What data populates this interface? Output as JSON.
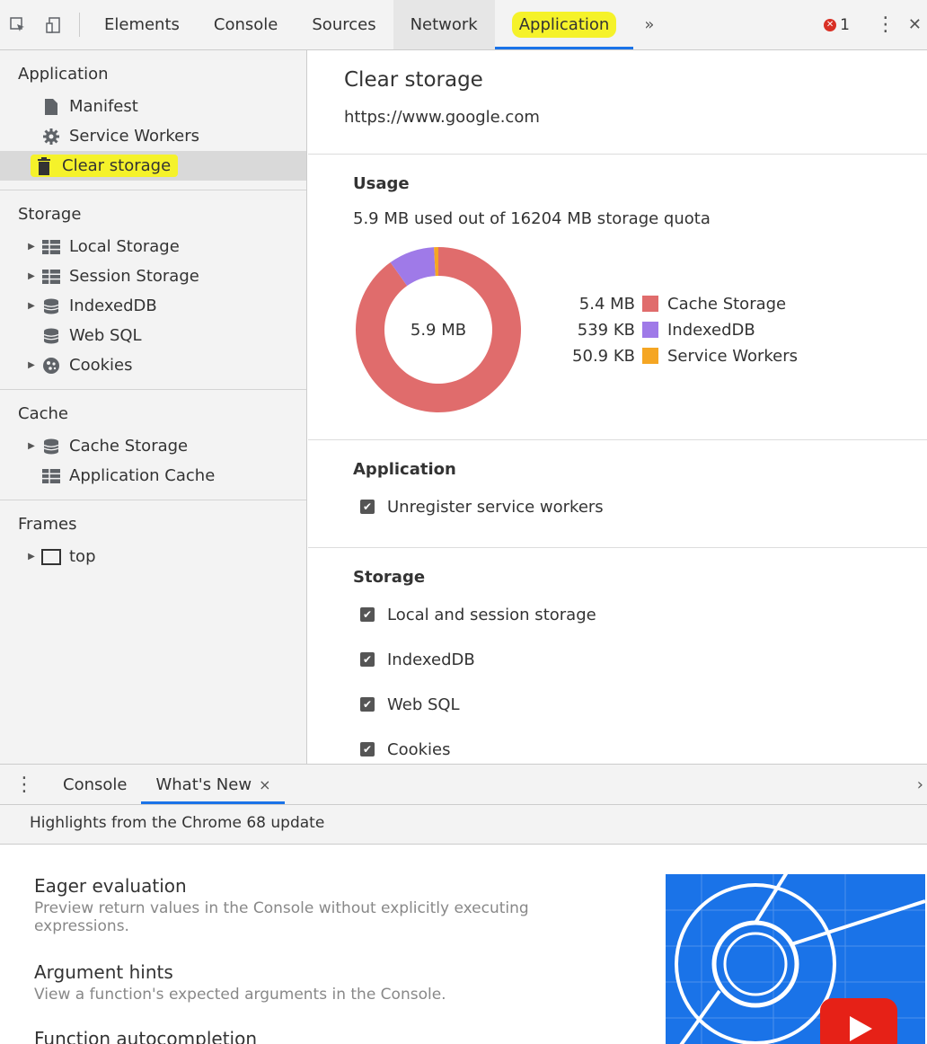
{
  "toolbar": {
    "tabs": [
      "Elements",
      "Console",
      "Sources",
      "Network",
      "Application"
    ],
    "more": "»",
    "error_count": "1"
  },
  "sidebar": {
    "sections": [
      {
        "title": "Application",
        "items": [
          {
            "label": "Manifest",
            "icon": "document-icon"
          },
          {
            "label": "Service Workers",
            "icon": "gear-icon"
          },
          {
            "label": "Clear storage",
            "icon": "trash-icon"
          }
        ]
      },
      {
        "title": "Storage",
        "items": [
          {
            "label": "Local Storage",
            "icon": "grid-icon"
          },
          {
            "label": "Session Storage",
            "icon": "grid-icon"
          },
          {
            "label": "IndexedDB",
            "icon": "database-icon"
          },
          {
            "label": "Web SQL",
            "icon": "database-icon"
          },
          {
            "label": "Cookies",
            "icon": "cookie-icon"
          }
        ]
      },
      {
        "title": "Cache",
        "items": [
          {
            "label": "Cache Storage",
            "icon": "database-icon"
          },
          {
            "label": "Application Cache",
            "icon": "grid-icon"
          }
        ]
      },
      {
        "title": "Frames",
        "items": [
          {
            "label": "top",
            "icon": "frame-icon"
          }
        ]
      }
    ]
  },
  "main": {
    "title": "Clear storage",
    "origin": "https://www.google.com",
    "usage": {
      "heading": "Usage",
      "summary": "5.9 MB used out of 16204 MB storage quota",
      "center_label": "5.9 MB",
      "legend": [
        {
          "amount": "5.4 MB",
          "label": "Cache Storage",
          "color": "#e06c6c"
        },
        {
          "amount": "539 KB",
          "label": "IndexedDB",
          "color": "#9f7ae8"
        },
        {
          "amount": "50.9 KB",
          "label": "Service Workers",
          "color": "#f5a623"
        }
      ]
    },
    "application": {
      "heading": "Application",
      "checks": [
        {
          "label": "Unregister service workers",
          "checked": true
        }
      ]
    },
    "storage": {
      "heading": "Storage",
      "checks": [
        {
          "label": "Local and session storage",
          "checked": true
        },
        {
          "label": "IndexedDB",
          "checked": true
        },
        {
          "label": "Web SQL",
          "checked": true
        },
        {
          "label": "Cookies",
          "checked": true
        }
      ]
    }
  },
  "chart_data": {
    "type": "pie",
    "title": "",
    "categories": [
      "Cache Storage",
      "IndexedDB",
      "Service Workers"
    ],
    "values": [
      5400,
      539,
      50.9
    ],
    "unit": "KB",
    "colors": [
      "#e06c6c",
      "#9f7ae8",
      "#f5a623"
    ],
    "center_label": "5.9 MB",
    "style": "donut"
  },
  "drawer": {
    "tabs": [
      "Console",
      "What's New"
    ],
    "close": "×",
    "right_arrow": "›",
    "heading": "Highlights from the Chrome 68 update",
    "features": [
      {
        "title": "Eager evaluation",
        "desc": "Preview return values in the Console without explicitly executing expressions."
      },
      {
        "title": "Argument hints",
        "desc": "View a function's expected arguments in the Console."
      },
      {
        "title": "Function autocompletion",
        "desc": ""
      }
    ]
  }
}
